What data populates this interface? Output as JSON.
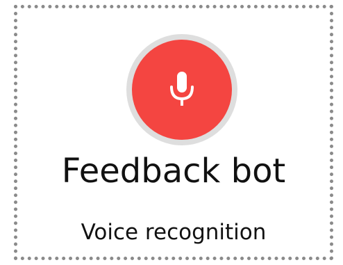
{
  "card": {
    "title": "Feedback bot",
    "subtitle": "Voice recognition"
  },
  "mic_button": {
    "icon": "microphone-icon",
    "ring_color": "#dedede",
    "fill_color": "#f44541",
    "icon_color": "#ffffff"
  }
}
